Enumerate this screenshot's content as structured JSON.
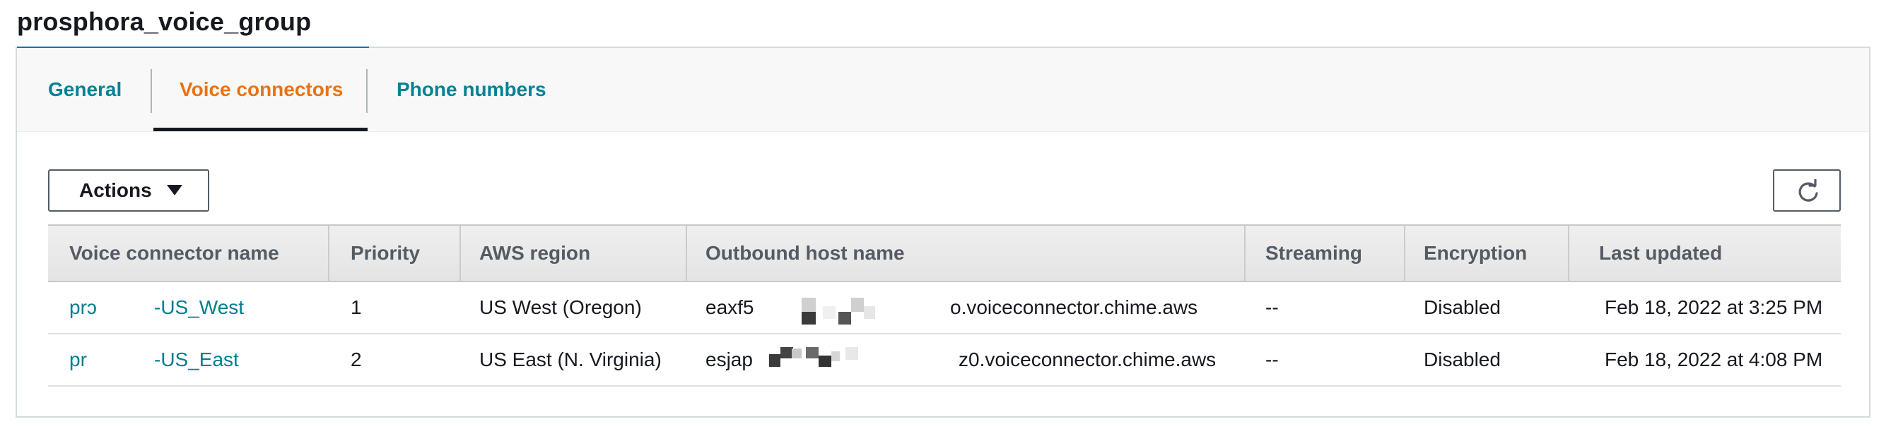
{
  "page": {
    "title": "prosphora_voice_group"
  },
  "tabs": [
    {
      "label": "General",
      "active": false
    },
    {
      "label": "Voice connectors",
      "active": true
    },
    {
      "label": "Phone numbers",
      "active": false
    }
  ],
  "toolbar": {
    "actions_label": "Actions",
    "refresh_icon": "refresh-icon"
  },
  "table": {
    "columns": [
      "Voice connector name",
      "Priority",
      "AWS region",
      "Outbound host name",
      "Streaming",
      "Encryption",
      "Last updated"
    ],
    "rows": [
      {
        "name_prefix": "prɔ",
        "name_suffix": "-US_West",
        "priority": "1",
        "region": "US West (Oregon)",
        "host_prefix": "eaxf5",
        "host_suffix": "o.voiceconnector.chime.aws",
        "streaming": "--",
        "encryption": "Disabled",
        "last_updated": "Feb 18, 2022 at 3:25 PM"
      },
      {
        "name_prefix": "pr",
        "name_suffix": "-US_East",
        "priority": "2",
        "region": "US East (N. Virginia)",
        "host_prefix": "esjap",
        "host_suffix": "z0.voiceconnector.chime.aws",
        "streaming": "--",
        "encryption": "Disabled",
        "last_updated": "Feb 18, 2022 at 4:08 PM"
      }
    ]
  },
  "colors": {
    "accent_orange": "#ec7211",
    "link_teal": "#008296",
    "text_dark": "#16191f"
  }
}
